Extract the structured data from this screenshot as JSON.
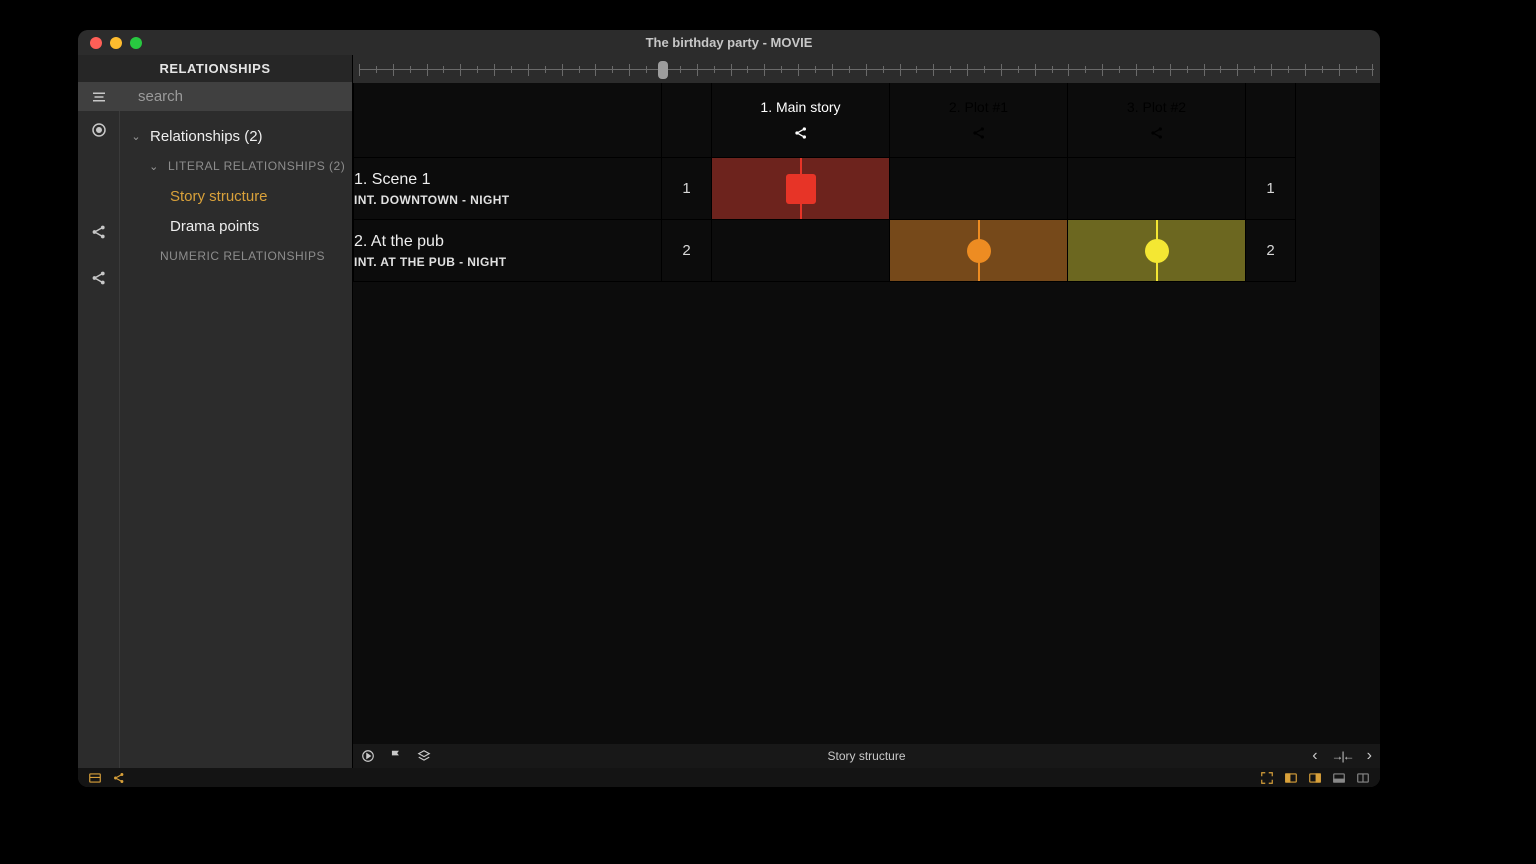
{
  "window": {
    "title": "The birthday party - MOVIE"
  },
  "sidebar": {
    "header": "RELATIONSHIPS",
    "search_placeholder": "search",
    "root_label": "Relationships (2)",
    "group_literal": "LITERAL RELATIONSHIPS (2)",
    "leaf_story": "Story structure",
    "leaf_drama": "Drama points",
    "group_numeric": "NUMERIC RELATIONSHIPS"
  },
  "plots": [
    {
      "label": "1. Main story",
      "color": "#e73427",
      "dark": "#6d231d"
    },
    {
      "label": "2. Plot #1",
      "color": "#ed8c22",
      "dark": "#76491a"
    },
    {
      "label": "3. Plot #2",
      "color": "#f4e733",
      "dark": "#6c6720"
    }
  ],
  "scenes": [
    {
      "num": "1",
      "title": "1. Scene 1",
      "slug": "INT.  DOWNTOWN - NIGHT",
      "marks": {
        "1": "square"
      }
    },
    {
      "num": "2",
      "title": "2. At the pub",
      "slug": "INT.  AT THE PUB - NIGHT",
      "marks": {
        "2": "circle",
        "3": "circle"
      }
    }
  ],
  "footer": {
    "caption": "Story structure"
  }
}
